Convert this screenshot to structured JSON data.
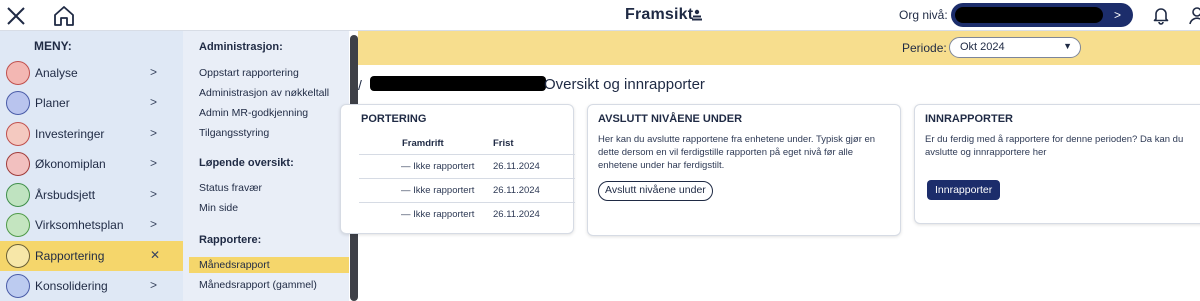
{
  "header": {
    "brand": "Framsikt",
    "org_label": "Org nivå:",
    "org_chevron": ">"
  },
  "menu": {
    "title": "MENY:",
    "items": [
      {
        "label": "Analyse",
        "icon": "analyse-icon",
        "chevron": ">"
      },
      {
        "label": "Planer",
        "icon": "planer-icon",
        "chevron": ">"
      },
      {
        "label": "Investeringer",
        "icon": "investeringer-icon",
        "chevron": ">"
      },
      {
        "label": "Økonomiplan",
        "icon": "okonomiplan-icon",
        "chevron": ">"
      },
      {
        "label": "Årsbudsjett",
        "icon": "arsbudsjett-icon",
        "chevron": ">"
      },
      {
        "label": "Virksomhetsplan",
        "icon": "virksomhetsplan-icon",
        "chevron": ">"
      },
      {
        "label": "Rapportering",
        "icon": "rapportering-icon",
        "chevron": "✕"
      },
      {
        "label": "Konsolidering",
        "icon": "konsolidering-icon",
        "chevron": ">"
      }
    ]
  },
  "submenu": {
    "sections": [
      {
        "heading": "Administrasjon:",
        "items": [
          "Oppstart rapportering",
          "Administrasjon av nøkkeltall",
          "Admin MR-godkjenning",
          "Tilgangsstyring"
        ]
      },
      {
        "heading": "Løpende oversikt:",
        "items": [
          "Status fravær",
          "Min side"
        ]
      },
      {
        "heading": "Rapportere:",
        "items": [
          "Månedsrapport",
          "Månedsrapport (gammel)"
        ]
      }
    ]
  },
  "period": {
    "label": "Periode:",
    "value": "Okt 2024"
  },
  "breadcrumb": {
    "separator": "/",
    "title": "Oversikt og innrapporter"
  },
  "cards": {
    "rapportering": {
      "heading": "PORTERING",
      "col_framdrift": "Framdrift",
      "col_frist": "Frist",
      "rows": [
        {
          "status": "— Ikke rapportert",
          "frist": "26.11.2024"
        },
        {
          "status": "— Ikke rapportert",
          "frist": "26.11.2024"
        },
        {
          "status": "— Ikke rapportert",
          "frist": "26.11.2024"
        }
      ]
    },
    "avslutt": {
      "heading": "AVSLUTT NIVÅENE UNDER",
      "text": "Her kan du avslutte rapportene fra enhetene under. Typisk gjør en dette dersom en vil ferdigstille rapporten på eget nivå før alle enhetene under har ferdigstilt.",
      "button": "Avslutt nivåene under"
    },
    "innrapporter": {
      "heading": "INNRAPPORTER",
      "text": "Er du ferdig med å rapportere for denne perioden? Da kan du avslutte og innrapportere her",
      "button": "Innrapporter"
    }
  },
  "colors": {
    "navy": "#1c2d6b",
    "yellow": "#f5d66b",
    "menu_bg": "#dfe8f5"
  }
}
